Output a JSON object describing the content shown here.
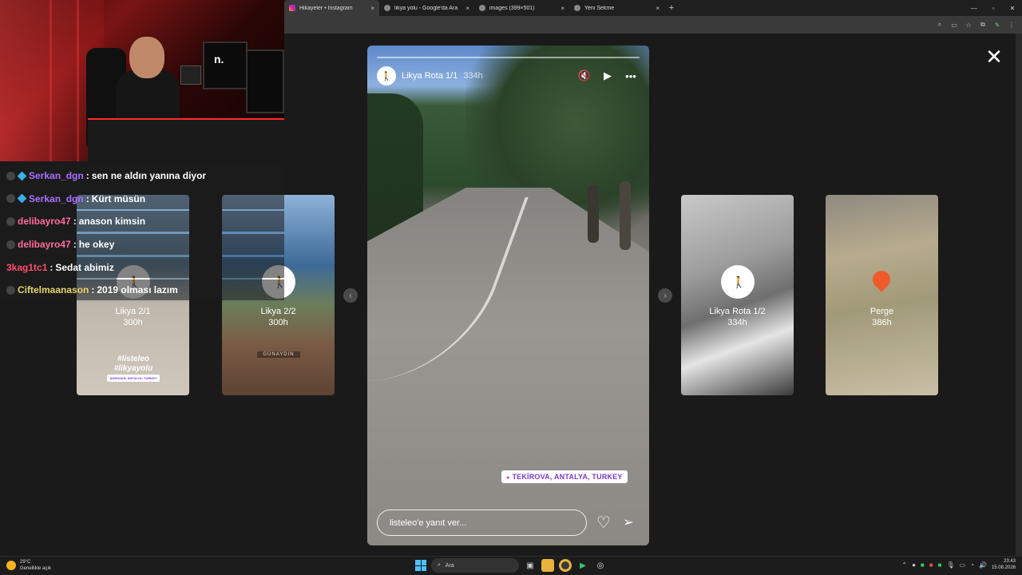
{
  "browser": {
    "tabs": [
      {
        "label": "Hikayeler • Instagram",
        "active": true
      },
      {
        "label": "likya yolu - Google'da Ara",
        "active": false
      },
      {
        "label": "images (399×501)",
        "active": false
      },
      {
        "label": "Yeni Sekme",
        "active": false
      }
    ],
    "new_tab": "+",
    "close_tab": "×",
    "window_controls": [
      "—",
      "▫",
      "✕"
    ],
    "toolbar_icons": [
      "zoom-icon",
      "cast-icon",
      "star-icon",
      "extensions-icon",
      "edit-icon",
      "menu-icon"
    ]
  },
  "chat": [
    {
      "user": "Serkan_dgn",
      "user_color": "#a970ff",
      "message": "sen ne aldın yanına diyor",
      "has_cube": true
    },
    {
      "user": "Serkan_dgn",
      "user_color": "#a970ff",
      "message": "Kürt müsün",
      "has_cube": true
    },
    {
      "user": "delibayro47",
      "user_color": "#ff6b9a",
      "message": "anason kimsin",
      "has_cube": false
    },
    {
      "user": "delibayro47",
      "user_color": "#ff6b9a",
      "message": "he okey",
      "has_cube": false
    },
    {
      "user": "3kag1tc1",
      "user_color": "#ff4d6d",
      "message": "Sedat abimiz",
      "has_cube": false
    },
    {
      "user": "Ciftelmaanason",
      "user_color": "#e6d36a",
      "message": "2019 olması lazım",
      "has_cube": false
    }
  ],
  "side_stories": [
    {
      "name": "Likya 2/1",
      "time": "300h",
      "overlay_text": "#listeleo #likyayolu",
      "tag": "ADRASAN, ANTALYA, TURKEY"
    },
    {
      "name": "Likya 2/2",
      "time": "300h",
      "overlay_text": "",
      "tag": "GÜNAYDIN"
    },
    {
      "name": "Likya Rota 1/2",
      "time": "334h"
    },
    {
      "name": "Perge",
      "time": "386h"
    }
  ],
  "story": {
    "name": "Likya Rota 1/1",
    "time": "334h",
    "location": "TEKİROVA, ANTALYA, TURKEY",
    "reply_placeholder": "listeleo'e yanıt ver...",
    "progress": 0.0
  },
  "close_label": "✕",
  "prev_arrow": "‹",
  "next_arrow": "›",
  "taskbar": {
    "weather_temp": "29°C",
    "weather_desc": "Genellikle açık",
    "search_label": "Ara",
    "time": "23:43",
    "date": "15.08.2026"
  }
}
